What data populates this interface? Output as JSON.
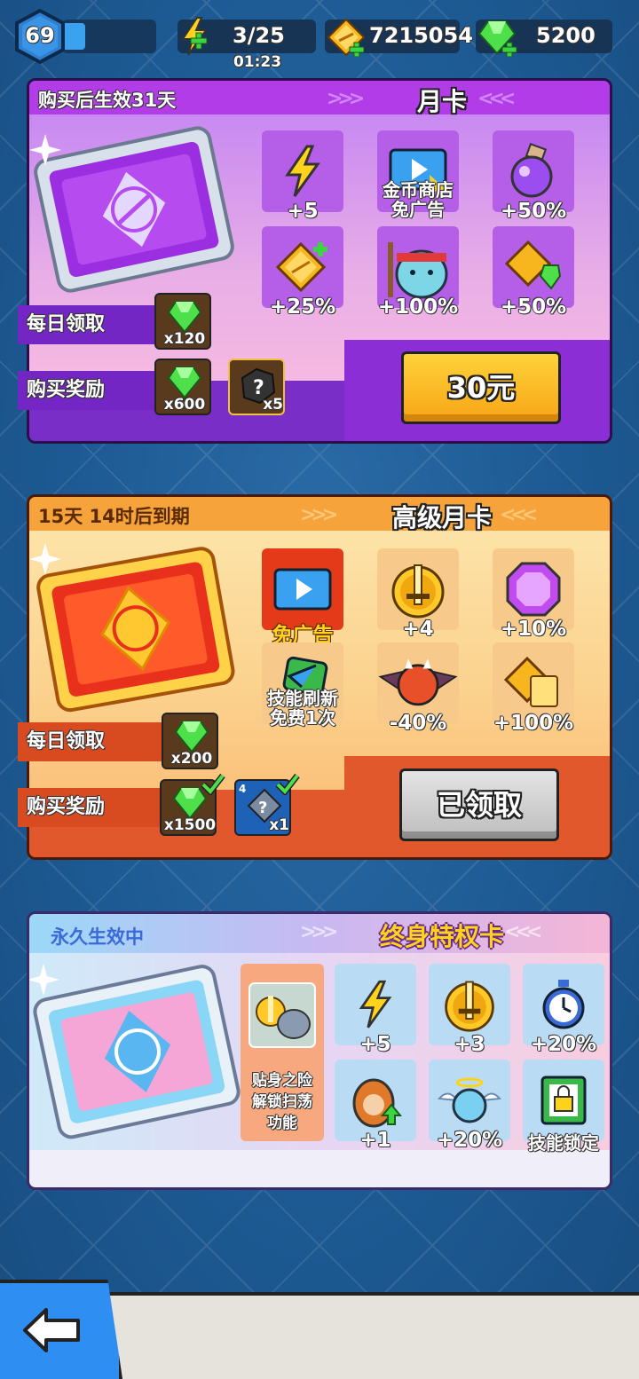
{
  "topbar": {
    "level": "69",
    "energy": "3/25",
    "energy_timer": "01:23",
    "gold": "7215054",
    "gems": "5200"
  },
  "monthly_card": {
    "status": "购买后生效31天",
    "title": "月卡",
    "perks": [
      {
        "label": "+5",
        "icon": "energy-icon"
      },
      {
        "label": "金币商店\n免广告",
        "icon": "video-ad-icon"
      },
      {
        "label": "+50%",
        "icon": "potion-icon"
      },
      {
        "label": "+25%",
        "icon": "gold-coin-icon"
      },
      {
        "label": "+100%",
        "icon": "pet-icon"
      },
      {
        "label": "+50%",
        "icon": "gold-gem-icon"
      }
    ],
    "daily_label": "每日领取",
    "daily_count": "x120",
    "purchase_label": "购买奖励",
    "purchase_gems": "x600",
    "purchase_mystery": "x5",
    "price": "30元",
    "colors": {
      "head": "#b13ce8",
      "body": "#f0a8e8",
      "accent": "#8a2cd6"
    }
  },
  "premium_card": {
    "status": "15天 14时后到期",
    "title": "高级月卡",
    "perks": [
      {
        "label": "免广告",
        "icon": "video-ad-icon"
      },
      {
        "label": "+4",
        "icon": "sword-medal-icon"
      },
      {
        "label": "+10%",
        "icon": "purple-gem-icon"
      },
      {
        "label": "技能刷新\n免费1次",
        "icon": "refresh-icon"
      },
      {
        "label": "-40%",
        "icon": "devil-icon"
      },
      {
        "label": "+100%",
        "icon": "gold-ticket-icon"
      }
    ],
    "daily_label": "每日领取",
    "daily_count": "x200",
    "purchase_label": "购买奖励",
    "purchase_gems": "x1500",
    "purchase_box": "x1",
    "purchase_box_level": "4",
    "button_label": "已领取",
    "colors": {
      "head": "#f5a33a",
      "body": "#fde3a8",
      "accent": "#e0582b"
    }
  },
  "lifetime_card": {
    "status": "永久生效中",
    "title": "终身特权卡",
    "special_perk": "贴身之险\n解锁扫荡\n功能",
    "perks": [
      {
        "label": "+5",
        "icon": "energy-icon"
      },
      {
        "label": "+3",
        "icon": "sword-medal-icon"
      },
      {
        "label": "+20%",
        "icon": "stopwatch-icon"
      },
      {
        "label": "+1",
        "icon": "hero-upgrade-icon"
      },
      {
        "label": "+20%",
        "icon": "angel-icon"
      },
      {
        "label": "技能锁定",
        "icon": "lock-icon"
      }
    ]
  }
}
